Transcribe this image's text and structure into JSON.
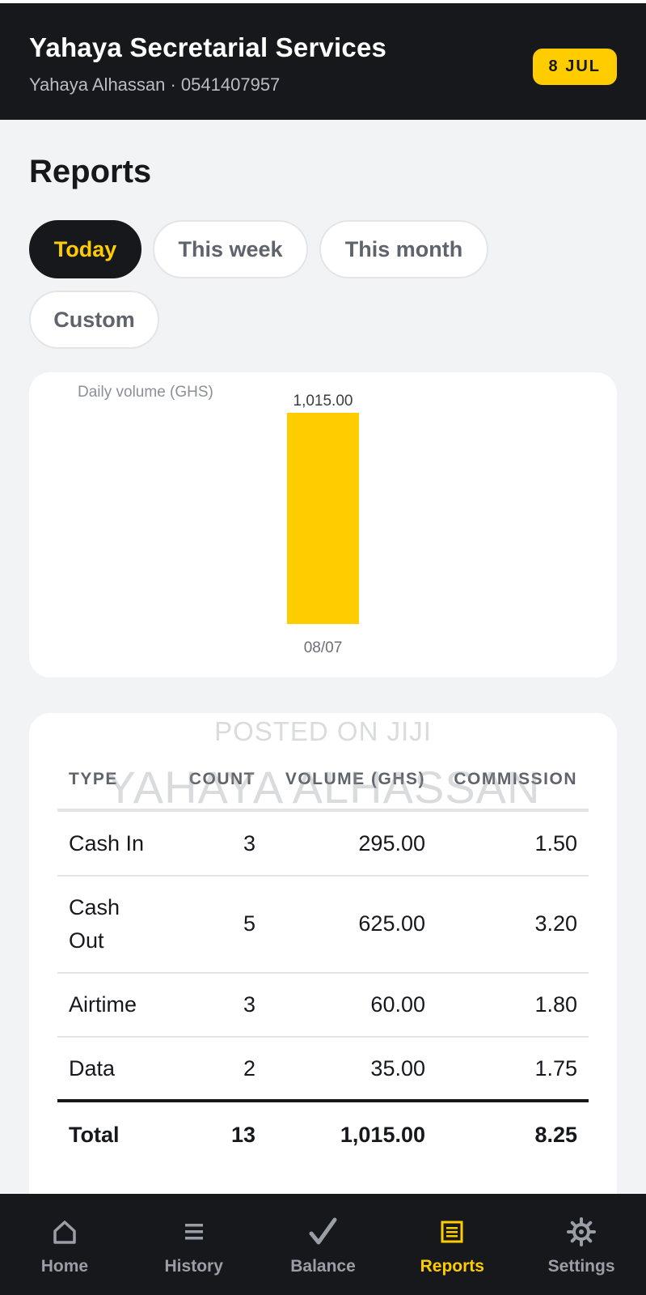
{
  "header": {
    "business_name": "Yahaya Secretarial Services",
    "subtitle": "Yahaya Alhassan · 0541407957",
    "date_badge": "8 JUL"
  },
  "page": {
    "title": "Reports"
  },
  "filters": [
    {
      "label": "Today",
      "active": true
    },
    {
      "label": "This week",
      "active": false
    },
    {
      "label": "This month",
      "active": false
    },
    {
      "label": "Custom",
      "active": false
    }
  ],
  "chart_data": {
    "type": "bar",
    "title": "Daily volume (GHS)",
    "categories": [
      "08/07"
    ],
    "values": [
      1015.0
    ],
    "value_labels": [
      "1,015.00"
    ],
    "color": "#ffcc00",
    "grid": false
  },
  "watermark": {
    "line1": "POSTED ON JIJI",
    "line2": "YAHAYA ALHASSAN"
  },
  "table": {
    "headers": [
      "TYPE",
      "COUNT",
      "VOLUME (GHS)",
      "COMMISSION"
    ],
    "rows": [
      {
        "type": "Cash In",
        "count": "3",
        "volume": "295.00",
        "commission": "1.50"
      },
      {
        "type": "Cash Out",
        "count": "5",
        "volume": "625.00",
        "commission": "3.20"
      },
      {
        "type": "Airtime",
        "count": "3",
        "volume": "60.00",
        "commission": "1.80"
      },
      {
        "type": "Data",
        "count": "2",
        "volume": "35.00",
        "commission": "1.75"
      }
    ],
    "total": {
      "type": "Total",
      "count": "13",
      "volume": "1,015.00",
      "commission": "8.25"
    }
  },
  "nav": [
    {
      "label": "Home",
      "icon": "home-icon",
      "active": false
    },
    {
      "label": "History",
      "icon": "list-icon",
      "active": false
    },
    {
      "label": "Balance",
      "icon": "check-icon",
      "active": false
    },
    {
      "label": "Reports",
      "icon": "report-icon",
      "active": true
    },
    {
      "label": "Settings",
      "icon": "gear-icon",
      "active": false
    }
  ],
  "colors": {
    "accent": "#ffcc00",
    "dark": "#16181c"
  }
}
